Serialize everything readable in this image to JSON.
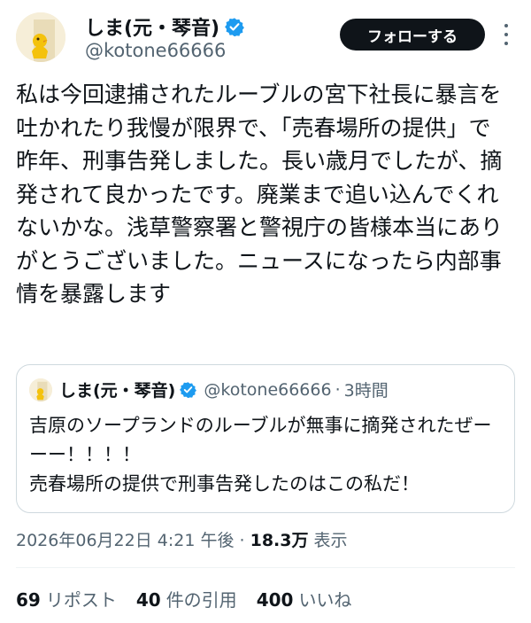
{
  "author": {
    "display_name": "しま(元・琴音)",
    "handle": "@kotone66666"
  },
  "follow_button_label": "フォローする",
  "tweet": {
    "text": "私は今回逮捕されたルーブルの宮下社長に暴言を吐かれたり我慢が限界で、「売春場所の提供」で昨年、刑事告発しました。長い歳月でしたが、摘発されて良かったです。廃業まで追い込んでくれないかな。浅草警察署と警視庁の皆様本当にありがとうございました。ニュースになったら内部事情を暴露します"
  },
  "quoted_tweet": {
    "display_name": "しま(元・琴音)",
    "handle": "@kotone66666",
    "separator": "·",
    "time": "3時間",
    "text": "吉原のソープランドのルーブルが無事に摘発されたぜーーー！！！！\n売春場所の提供で刑事告発したのはこの私だ！"
  },
  "meta": {
    "timestamp": "2026年06月22日 4:21 午後",
    "separator": "·",
    "views_count": "18.3万",
    "views_label": "表示"
  },
  "stats": {
    "reposts_count": "69",
    "reposts_label": "リポスト",
    "quotes_count": "40",
    "quotes_label": "件の引用",
    "likes_count": "400",
    "likes_label": "いいね"
  },
  "icons": {
    "verified": "verified-badge-icon",
    "more": "more-options-icon"
  },
  "colors": {
    "text": "#0f1419",
    "secondary": "#536471",
    "verified": "#1d9bf0",
    "follow_button": "#0f1419",
    "border": "#cfd9de"
  }
}
